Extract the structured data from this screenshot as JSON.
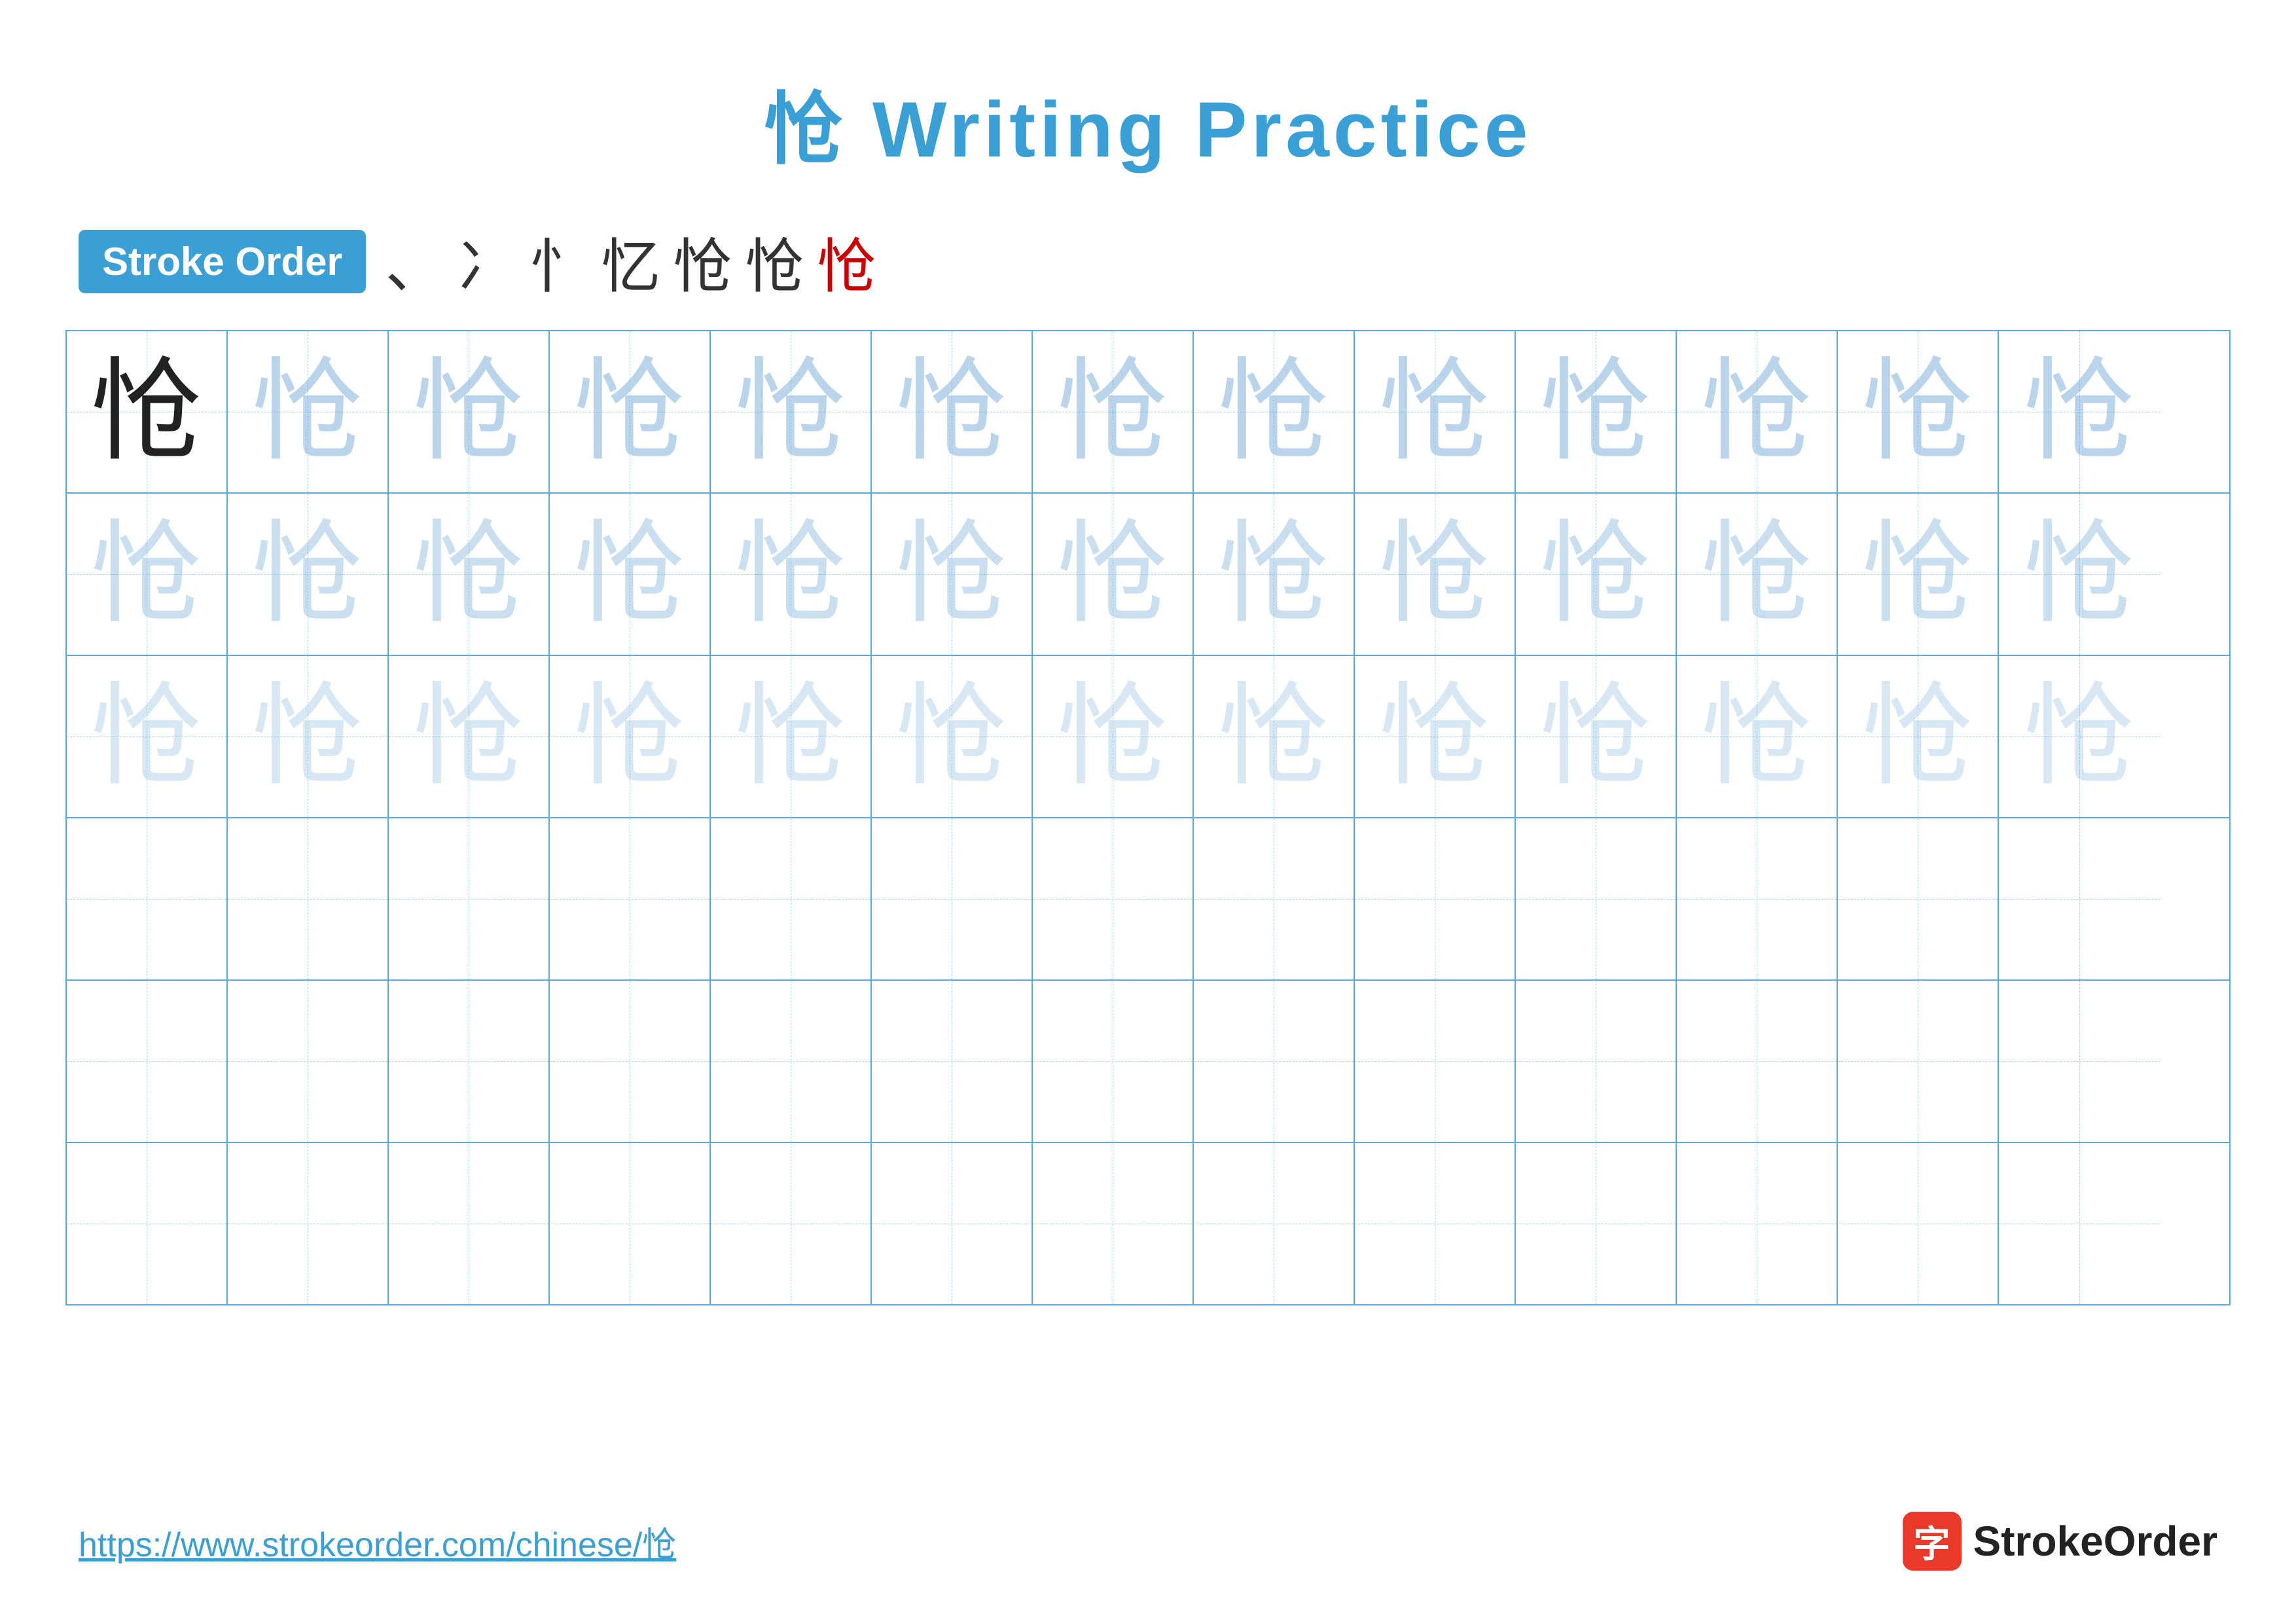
{
  "title": {
    "character": "怆",
    "label": "Writing Practice",
    "full": "怆 Writing Practice"
  },
  "stroke_order": {
    "badge_label": "Stroke Order",
    "strokes": [
      "、",
      "⺈",
      "忄",
      "忄",
      "忆",
      "怆",
      "怆"
    ]
  },
  "grid": {
    "rows": 6,
    "cols": 13,
    "character": "怆",
    "row_types": [
      "solid_then_dark",
      "medium",
      "light",
      "empty",
      "empty",
      "empty"
    ]
  },
  "footer": {
    "url": "https://www.strokeorder.com/chinese/怆",
    "logo_icon": "字",
    "logo_text": "StrokeOrder"
  }
}
